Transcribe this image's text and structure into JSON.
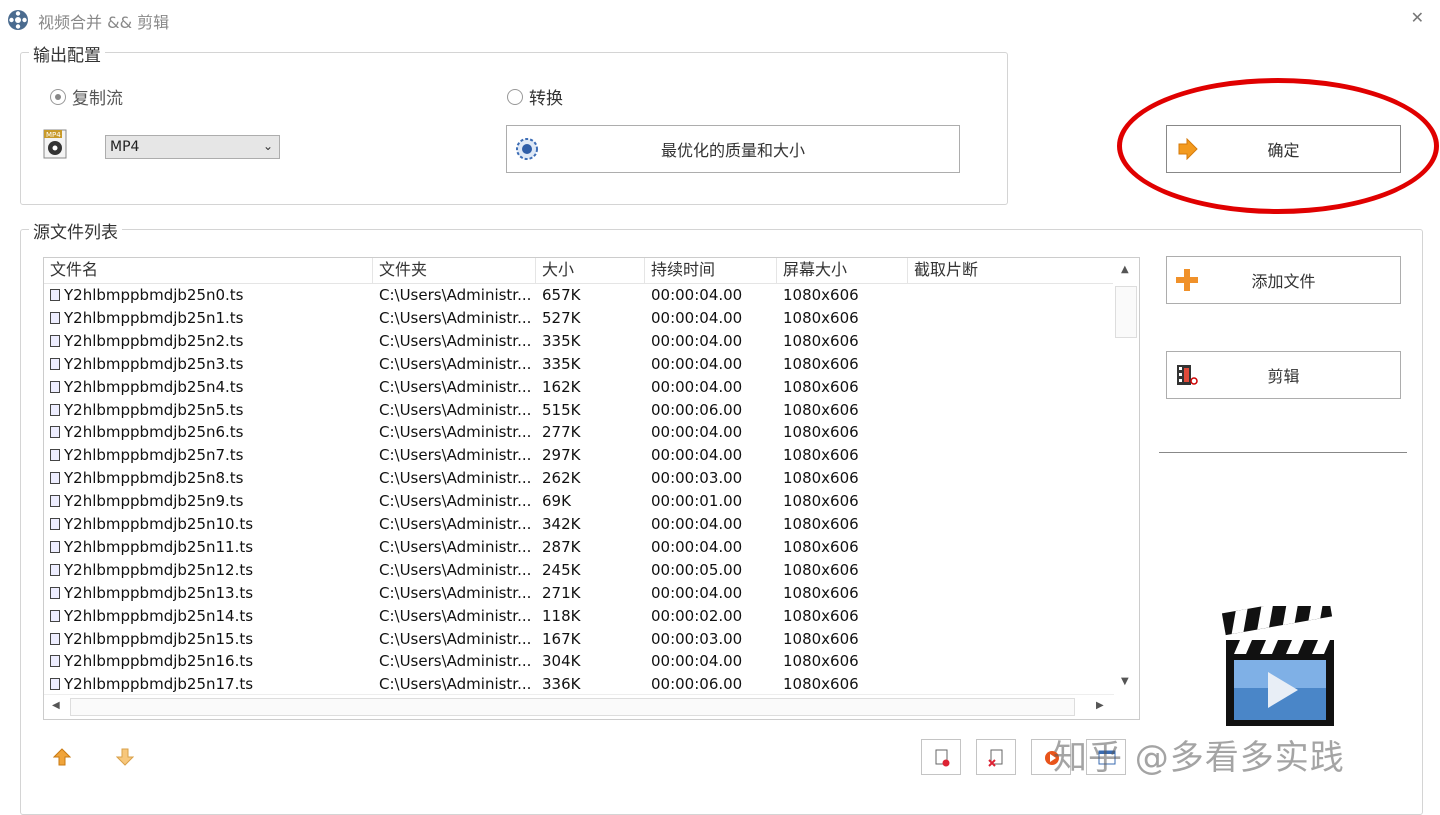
{
  "window": {
    "title": "视频合并 && 剪辑",
    "close_glyph": "✕"
  },
  "output_config": {
    "label": "输出配置",
    "radio_copy": "复制流",
    "radio_convert": "转换",
    "selected_radio": "复制流",
    "format_value": "MP4",
    "format_icon_text": "MP4",
    "quality_button": "最优化的质量和大小"
  },
  "confirm_button": "确定",
  "source_list": {
    "label": "源文件列表",
    "columns": [
      "文件名",
      "文件夹",
      "大小",
      "持续时间",
      "屏幕大小",
      "截取片断"
    ],
    "rows": [
      [
        "Y2hlbmppbmdjb25n0.ts",
        "C:\\Users\\Administr...",
        "657K",
        "00:00:04.00",
        "1080x606"
      ],
      [
        "Y2hlbmppbmdjb25n1.ts",
        "C:\\Users\\Administr...",
        "527K",
        "00:00:04.00",
        "1080x606"
      ],
      [
        "Y2hlbmppbmdjb25n2.ts",
        "C:\\Users\\Administr...",
        "335K",
        "00:00:04.00",
        "1080x606"
      ],
      [
        "Y2hlbmppbmdjb25n3.ts",
        "C:\\Users\\Administr...",
        "335K",
        "00:00:04.00",
        "1080x606"
      ],
      [
        "Y2hlbmppbmdjb25n4.ts",
        "C:\\Users\\Administr...",
        "162K",
        "00:00:04.00",
        "1080x606"
      ],
      [
        "Y2hlbmppbmdjb25n5.ts",
        "C:\\Users\\Administr...",
        "515K",
        "00:00:06.00",
        "1080x606"
      ],
      [
        "Y2hlbmppbmdjb25n6.ts",
        "C:\\Users\\Administr...",
        "277K",
        "00:00:04.00",
        "1080x606"
      ],
      [
        "Y2hlbmppbmdjb25n7.ts",
        "C:\\Users\\Administr...",
        "297K",
        "00:00:04.00",
        "1080x606"
      ],
      [
        "Y2hlbmppbmdjb25n8.ts",
        "C:\\Users\\Administr...",
        "262K",
        "00:00:03.00",
        "1080x606"
      ],
      [
        "Y2hlbmppbmdjb25n9.ts",
        "C:\\Users\\Administr...",
        "69K",
        "00:00:01.00",
        "1080x606"
      ],
      [
        "Y2hlbmppbmdjb25n10.ts",
        "C:\\Users\\Administr...",
        "342K",
        "00:00:04.00",
        "1080x606"
      ],
      [
        "Y2hlbmppbmdjb25n11.ts",
        "C:\\Users\\Administr...",
        "287K",
        "00:00:04.00",
        "1080x606"
      ],
      [
        "Y2hlbmppbmdjb25n12.ts",
        "C:\\Users\\Administr...",
        "245K",
        "00:00:05.00",
        "1080x606"
      ],
      [
        "Y2hlbmppbmdjb25n13.ts",
        "C:\\Users\\Administr...",
        "271K",
        "00:00:04.00",
        "1080x606"
      ],
      [
        "Y2hlbmppbmdjb25n14.ts",
        "C:\\Users\\Administr...",
        "118K",
        "00:00:02.00",
        "1080x606"
      ],
      [
        "Y2hlbmppbmdjb25n15.ts",
        "C:\\Users\\Administr...",
        "167K",
        "00:00:03.00",
        "1080x606"
      ],
      [
        "Y2hlbmppbmdjb25n16.ts",
        "C:\\Users\\Administr...",
        "304K",
        "00:00:04.00",
        "1080x606"
      ],
      [
        "Y2hlbmppbmdjb25n17.ts",
        "C:\\Users\\Administr...",
        "336K",
        "00:00:06.00",
        "1080x606"
      ]
    ]
  },
  "side_buttons": {
    "add_file": "添加文件",
    "edit": "剪辑"
  },
  "watermark": "知乎 @多看多实践",
  "colors": {
    "highlight_ellipse": "#e00000",
    "confirm_arrow": "#f39a1e",
    "add_plus": "#f0912a"
  }
}
